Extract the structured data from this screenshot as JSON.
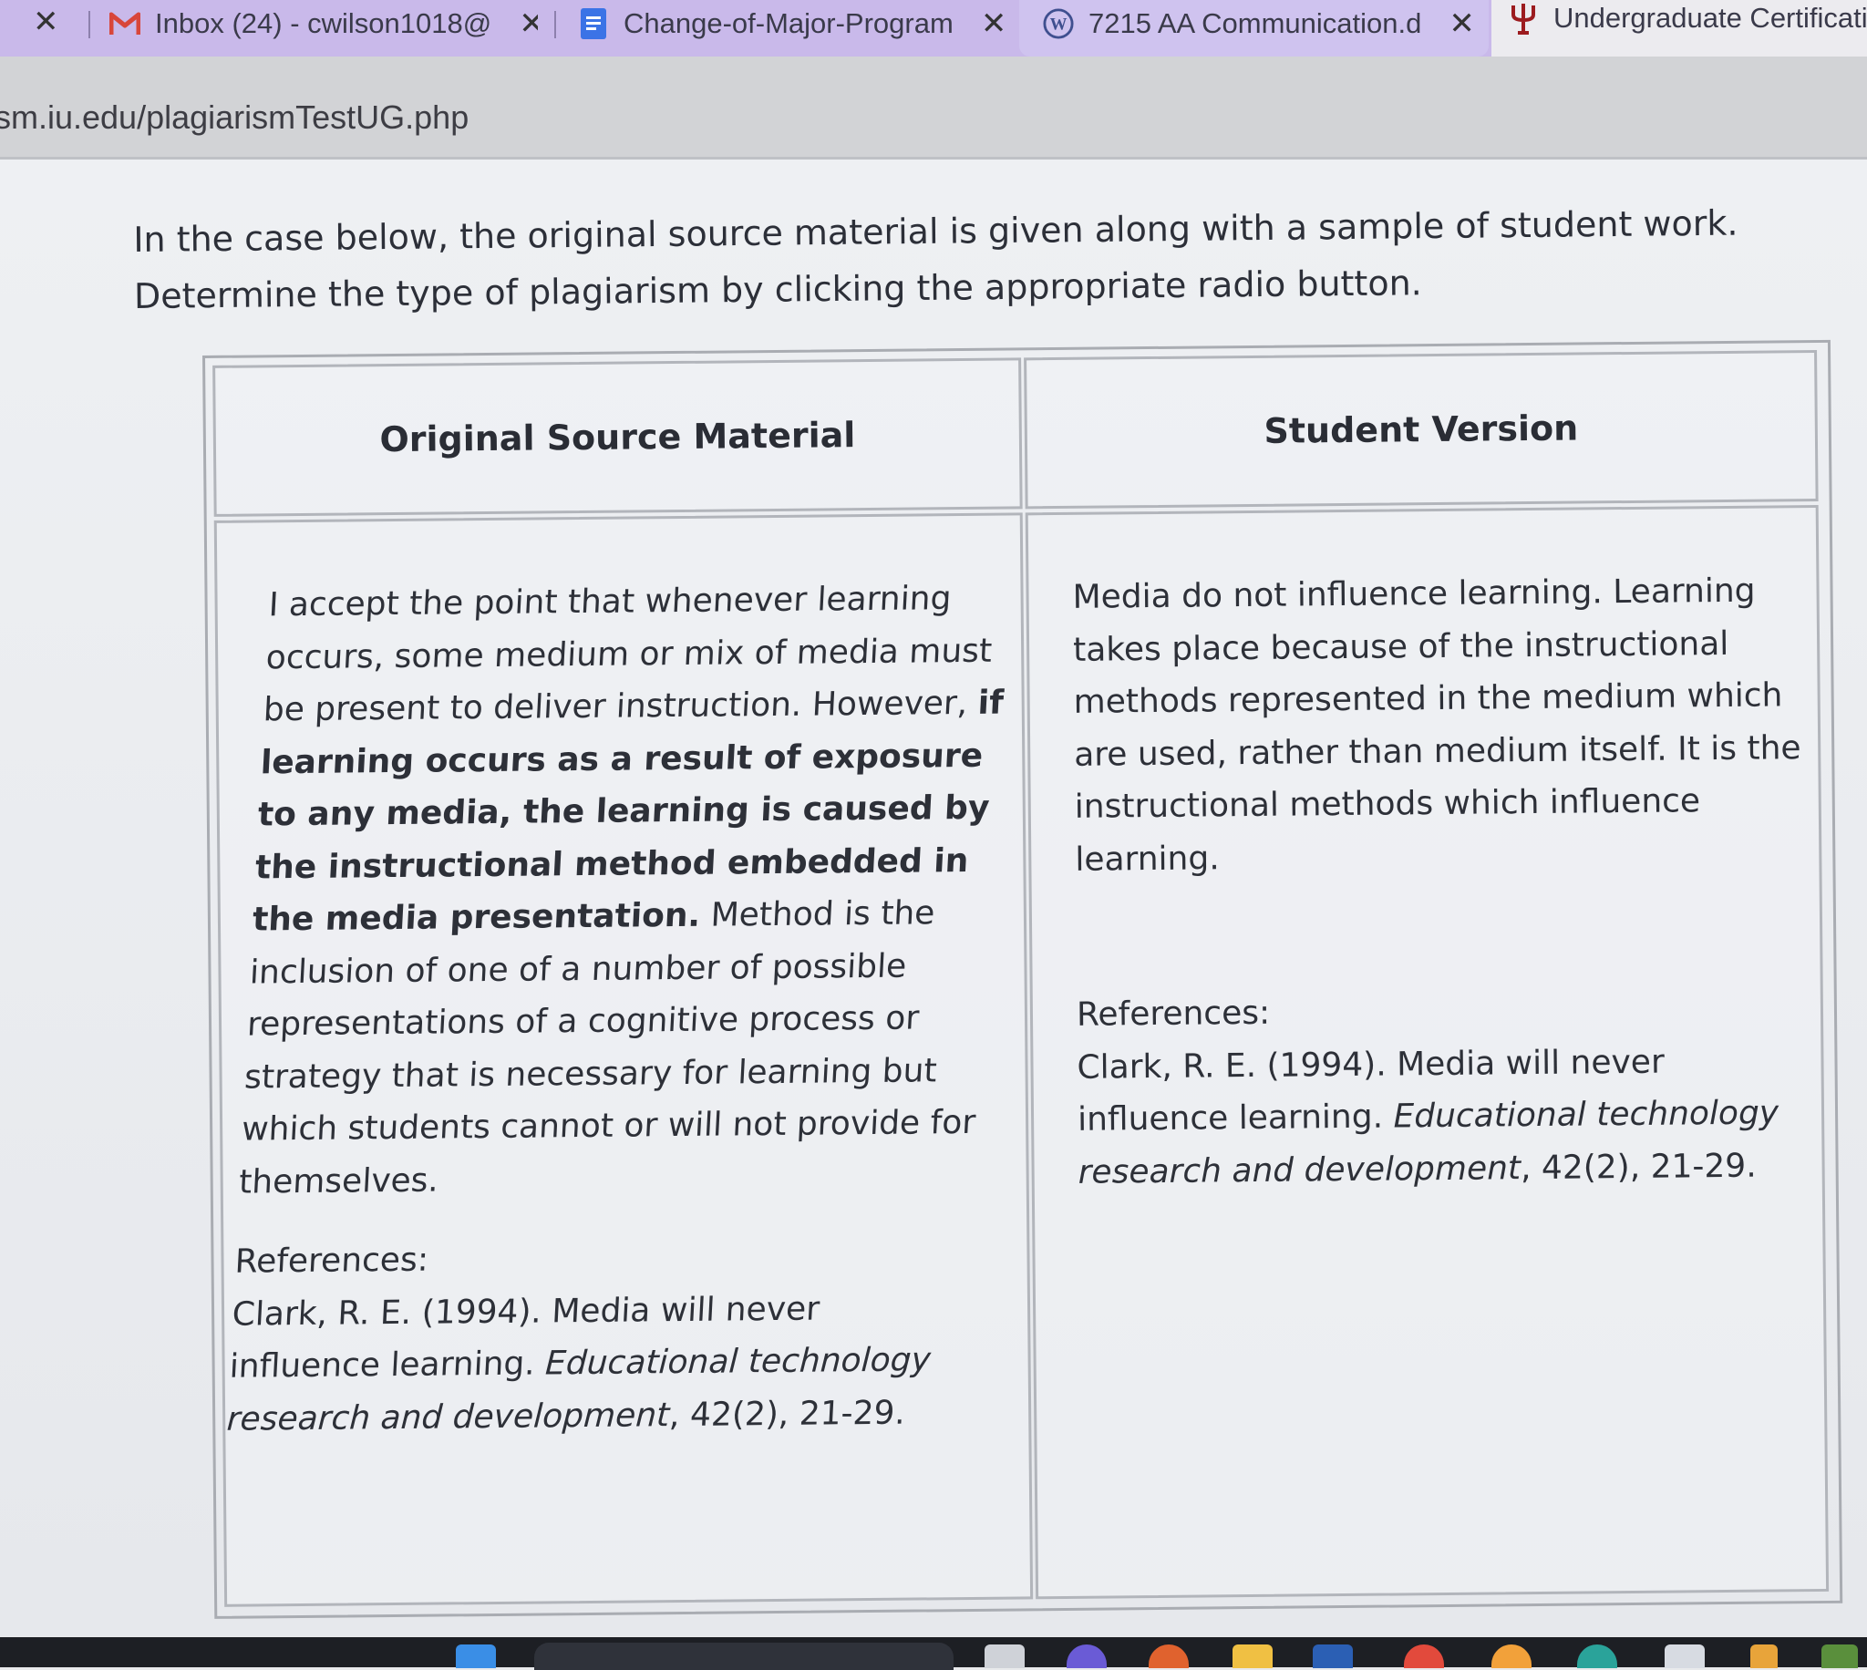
{
  "browser": {
    "tabs": [
      {
        "title": "Inbox (24) - cwilson1018@",
        "icon": "gmail-icon",
        "accent": "#d8463a"
      },
      {
        "title": "Change-of-Major-Program",
        "icon": "google-docs-icon",
        "accent": "#3b73e6"
      },
      {
        "title": "7215 AA Communication.d",
        "icon": "wordpress-icon",
        "accent": "#3f4f8f"
      },
      {
        "title": "Undergraduate Certificatio",
        "icon": "iu-trident-icon",
        "accent": "#9c1b1f"
      }
    ],
    "close_glyph": "✕",
    "url": "sm.iu.edu/plagiarismTestUG.php"
  },
  "page": {
    "instructions_line1": "In the case below, the original source material is given along with a sample of student work.",
    "instructions_line2": "Determine the type of plagiarism by clicking the appropriate radio button.",
    "table": {
      "col1_header": "Original Source Material",
      "col2_header": "Student Version",
      "original": {
        "text_before_bold": "I accept the point that whenever learning occurs, some medium or mix of media must be present to deliver instruction. However, ",
        "bold_text": "if learning occurs as a result of exposure to any media, the learning is caused by the instructional method embedded in the media presentation.",
        "text_after_bold": " Method is the inclusion of one of a number of possible representations of a cognitive process or strategy that is necessary for learning but which students cannot or will not provide for themselves.",
        "references_label": "References:",
        "reference_plain": "Clark, R. E. (1994). Media will never influence learning. ",
        "reference_italic": "Educational technology research and development",
        "reference_tail": ", 42(2), 21-29."
      },
      "student": {
        "text": "Media do not influence learning. Learning takes place because of the instructional methods represented in the medium which are used, rather than medium itself. It is the instructional methods which influence learning.",
        "references_label": "References:",
        "reference_plain": "Clark, R. E. (1994). Media will never influence learning. ",
        "reference_italic": "Educational technology research and development",
        "reference_tail": ", 42(2), 21-29."
      }
    }
  },
  "colors": {
    "tabstrip": "#c9b9ea",
    "address_bar": "#d2d3d6",
    "page_bg": "#eef0f3",
    "text": "#2c2f38",
    "taskbar": "#1d1f24"
  }
}
